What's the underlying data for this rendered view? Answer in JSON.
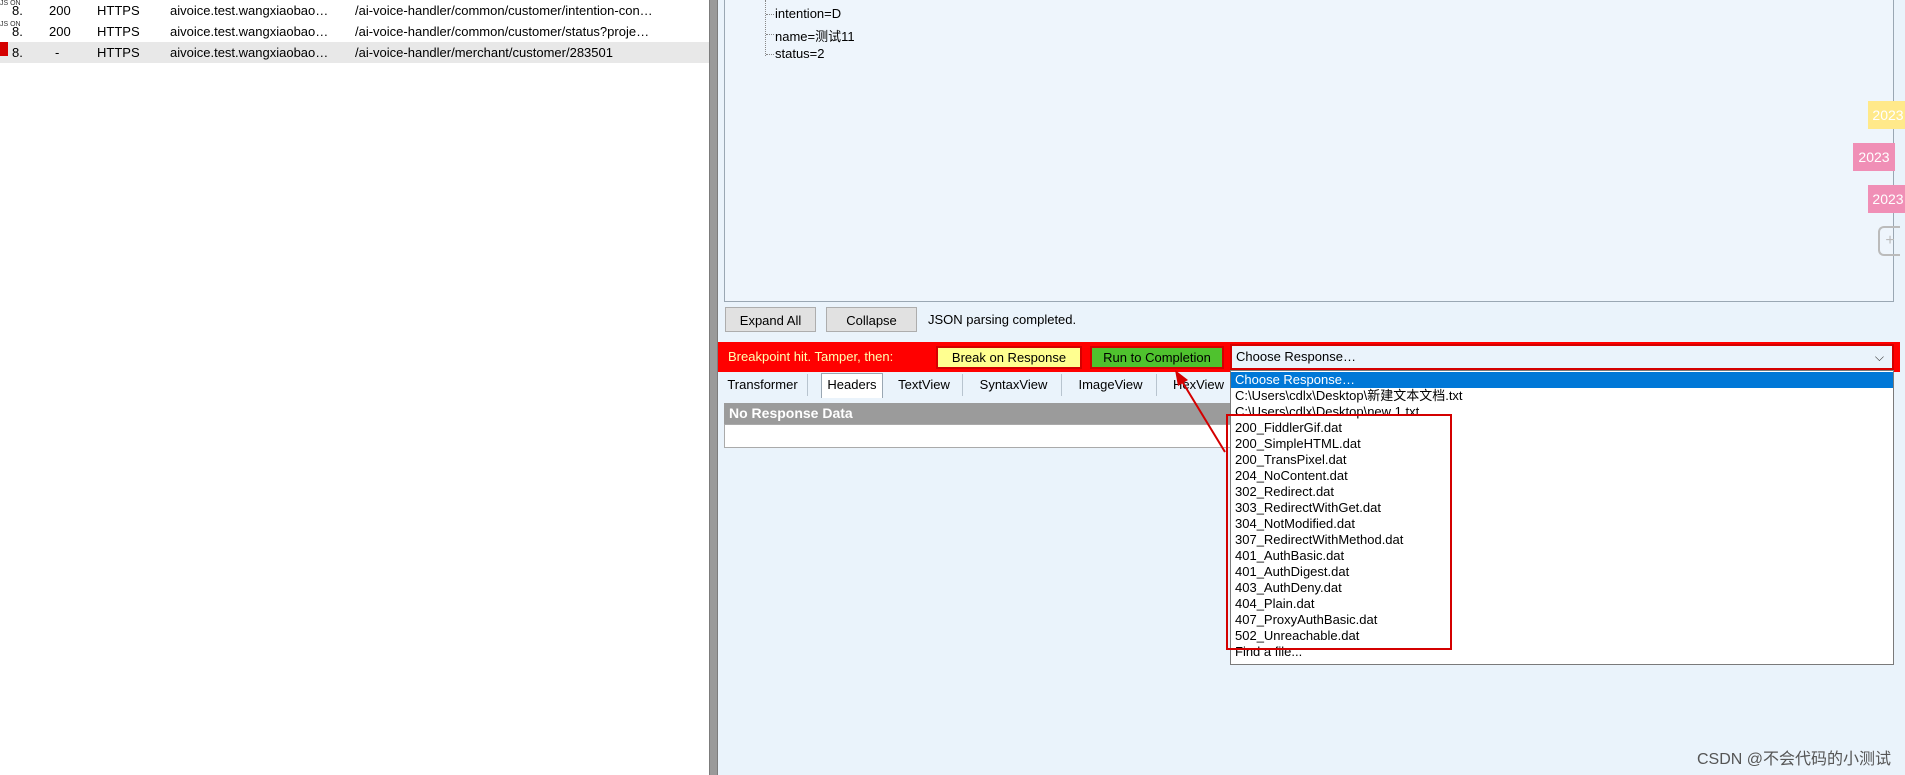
{
  "sessions": [
    {
      "num": "8.",
      "result": "200",
      "protocol": "HTTPS",
      "host": "aivoice.test.wangxiaobao…",
      "url": "/ai-voice-handler/common/customer/intention-con…",
      "icon_text": "JS ON",
      "selected": false
    },
    {
      "num": "8.",
      "result": "200",
      "protocol": "HTTPS",
      "host": "aivoice.test.wangxiaobao…",
      "url": "/ai-voice-handler/common/customer/status?proje…",
      "icon_text": "JS ON",
      "selected": false
    },
    {
      "num": "8.",
      "result": "-",
      "protocol": "HTTPS",
      "host": "aivoice.test.wangxiaobao…",
      "url": "/ai-voice-handler/merchant/customer/283501",
      "icon_text": "",
      "selected": true
    }
  ],
  "tree": {
    "nodes": [
      "intention=D",
      "name=测试11",
      "status=2"
    ]
  },
  "notes": [
    "2023",
    "2023",
    "2023"
  ],
  "buttons": {
    "expand_all": "Expand All",
    "collapse": "Collapse",
    "parse_status": "JSON parsing completed."
  },
  "breakpoint": {
    "label": "Breakpoint hit. Tamper, then:",
    "break_on_response": "Break on Response",
    "run_to_completion": "Run to Completion"
  },
  "combo": {
    "value": "Choose Response…",
    "arrow": "⌵"
  },
  "tabs": [
    "Transformer",
    "Headers",
    "TextView",
    "SyntaxView",
    "ImageView",
    "HexView"
  ],
  "no_response": "No Response Data",
  "dropdown": [
    "Choose Response…",
    "C:\\Users\\cdlx\\Desktop\\新建文本文档.txt",
    "C:\\Users\\cdlx\\Desktop\\new 1.txt",
    "200_FiddlerGif.dat",
    "200_SimpleHTML.dat",
    "200_TransPixel.dat",
    "204_NoContent.dat",
    "302_Redirect.dat",
    "303_RedirectWithGet.dat",
    "304_NotModified.dat",
    "307_RedirectWithMethod.dat",
    "401_AuthBasic.dat",
    "401_AuthDigest.dat",
    "403_AuthDeny.dat",
    "404_Plain.dat",
    "407_ProxyAuthBasic.dat",
    "502_Unreachable.dat",
    "Find a file..."
  ],
  "watermark": "CSDN @不会代码的小测试",
  "colors": {
    "breakpoint_bar": "#ff0000",
    "break_button": "#ffff90",
    "run_button": "#4fc22e",
    "selection": "#0078d7",
    "highlight_box": "#d40000"
  }
}
